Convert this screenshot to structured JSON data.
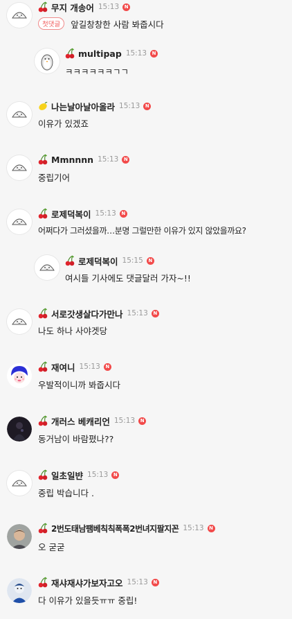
{
  "colors": {
    "background": "#f6f6f6",
    "new_badge": "#f24a4a",
    "first_comment_badge": "#f05a5a",
    "time": "#9a9a9a"
  },
  "comments": [
    {
      "nick": "무지 개송어",
      "fruit": "cherry",
      "avatar": "default-face",
      "time": "15:13",
      "new_label": "N",
      "badge": "첫댓글",
      "text": "앞길창창한 사람 봐줍시다"
    },
    {
      "nick": "multipap",
      "fruit": "cherry",
      "avatar": "penguin",
      "time": "15:13",
      "new_label": "N",
      "text": "ㅋㅋㅋㅋㅋㅋㄱㄱ",
      "reply": true
    },
    {
      "nick": "나는날아날아올라",
      "fruit": "lemon",
      "avatar": "default-face",
      "time": "15:13",
      "new_label": "N",
      "text": "이유가 있겠죠"
    },
    {
      "nick": "Mmnnnn",
      "fruit": "cherry",
      "avatar": "default-face",
      "time": "15:13",
      "new_label": "N",
      "text": "중립기어"
    },
    {
      "nick": "로제덕복이",
      "fruit": "cherry",
      "avatar": "default-face",
      "time": "15:13",
      "new_label": "N",
      "text": "어쩌다가 그러셨을까…분명 그럴만한 이유가 있지 않았을까요?"
    },
    {
      "nick": "로제덕복이",
      "fruit": "cherry",
      "avatar": "default-face",
      "time": "15:15",
      "new_label": "N",
      "text": "여시들 기사에도 댓글달러 가자~!!",
      "reply": true
    },
    {
      "nick": "서로갓생살다가만나",
      "fruit": "cherry",
      "avatar": "default-face",
      "time": "15:13",
      "new_label": "N",
      "text": "나도 하나 사야겟당"
    },
    {
      "nick": "재여니",
      "fruit": "cherry",
      "avatar": "blue-hair-character",
      "time": "15:13",
      "new_label": "N",
      "text": "우발적이니까 봐줍시다"
    },
    {
      "nick": "개러스 베캐리언",
      "fruit": "cherry",
      "avatar": "dark-photo",
      "time": "15:13",
      "new_label": "N",
      "text": "동거남이 바람폈나??"
    },
    {
      "nick": "일초일뱐",
      "fruit": "cherry",
      "avatar": "default-face",
      "time": "15:13",
      "new_label": "N",
      "text": "중립 박습니다 ."
    },
    {
      "nick": "2번도태남팸베칙칙폭폭2번녀지팔지꼰",
      "fruit": "cherry",
      "avatar": "man-photo",
      "time": "15:13",
      "new_label": "N",
      "text": "오 굳굳"
    },
    {
      "nick": "재샤재샤가보자고오",
      "fruit": "cherry",
      "avatar": "blue-character",
      "time": "15:13",
      "new_label": "N",
      "text": "다 이유가 있을듯ㅠㅠ 중립!"
    }
  ]
}
